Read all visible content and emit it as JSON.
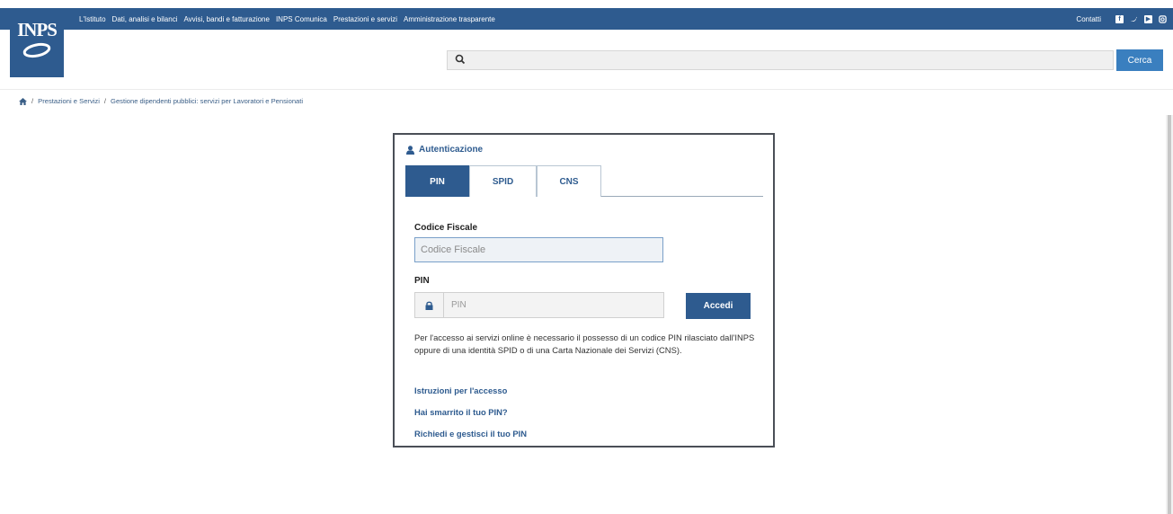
{
  "header": {
    "logo_text": "INPS",
    "nav": [
      "L'Istituto",
      "Dati, analisi e bilanci",
      "Avvisi, bandi e fatturazione",
      "INPS Comunica",
      "Prestazioni e servizi",
      "Amministrazione trasparente"
    ],
    "contacts_label": "Contatti",
    "social_icons": [
      "facebook-icon",
      "twitter-icon",
      "youtube-icon",
      "instagram-icon"
    ],
    "search": {
      "placeholder": "",
      "button_label": "Cerca"
    },
    "brand_color": "#2e5b8f"
  },
  "breadcrumb": {
    "items": [
      "Prestazioni e Servizi",
      "Gestione dipendenti pubblici: servizi per Lavoratori e Pensionati"
    ]
  },
  "login": {
    "title": "Autenticazione",
    "tabs": [
      {
        "label": "PIN",
        "active": true
      },
      {
        "label": "SPID",
        "active": false
      },
      {
        "label": "CNS",
        "active": false
      }
    ],
    "codice_fiscale_label": "Codice Fiscale",
    "codice_fiscale_placeholder": "Codice Fiscale",
    "pin_label": "PIN",
    "pin_placeholder": "PIN",
    "submit_label": "Accedi",
    "info_text": "Per l'accesso ai servizi online è necessario il possesso di un codice PIN rilasciato dall'INPS oppure di una identità SPID o di una Carta Nazionale dei Servizi (CNS).",
    "links": [
      "Istruzioni per l'accesso",
      "Hai smarrito il tuo PIN?",
      "Richiedi e gestisci il tuo PIN"
    ]
  }
}
